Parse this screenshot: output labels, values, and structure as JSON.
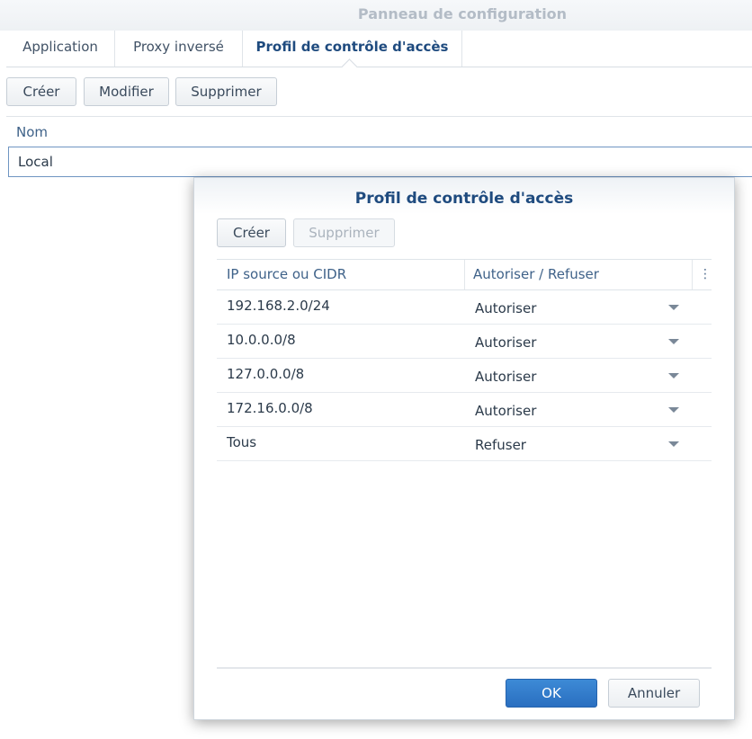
{
  "window": {
    "title": "Panneau de configuration"
  },
  "tabs": [
    {
      "label": "Application"
    },
    {
      "label": "Proxy inversé"
    },
    {
      "label": "Profil de contrôle d'accès"
    }
  ],
  "toolbar": {
    "create": "Créer",
    "edit": "Modifier",
    "delete": "Supprimer"
  },
  "list": {
    "column": "Nom",
    "rows": [
      {
        "name": "Local"
      }
    ]
  },
  "dialog": {
    "title": "Profil de contrôle d'accès",
    "toolbar": {
      "create": "Créer",
      "delete": "Supprimer"
    },
    "columns": {
      "ip": "IP source ou CIDR",
      "action": "Autoriser / Refuser",
      "menu_icon": "vertical-ellipsis-icon"
    },
    "rows": [
      {
        "ip": "192.168.2.0/24",
        "action": "Autoriser"
      },
      {
        "ip": "10.0.0.0/8",
        "action": "Autoriser"
      },
      {
        "ip": "127.0.0.0/8",
        "action": "Autoriser"
      },
      {
        "ip": "172.16.0.0/8",
        "action": "Autoriser"
      },
      {
        "ip": "Tous",
        "action": "Refuser"
      }
    ],
    "buttons": {
      "ok": "OK",
      "cancel": "Annuler"
    }
  },
  "colors": {
    "accent": "#2a6fc0",
    "title": "#1f4b7f",
    "selection_border": "#6f95c2"
  }
}
